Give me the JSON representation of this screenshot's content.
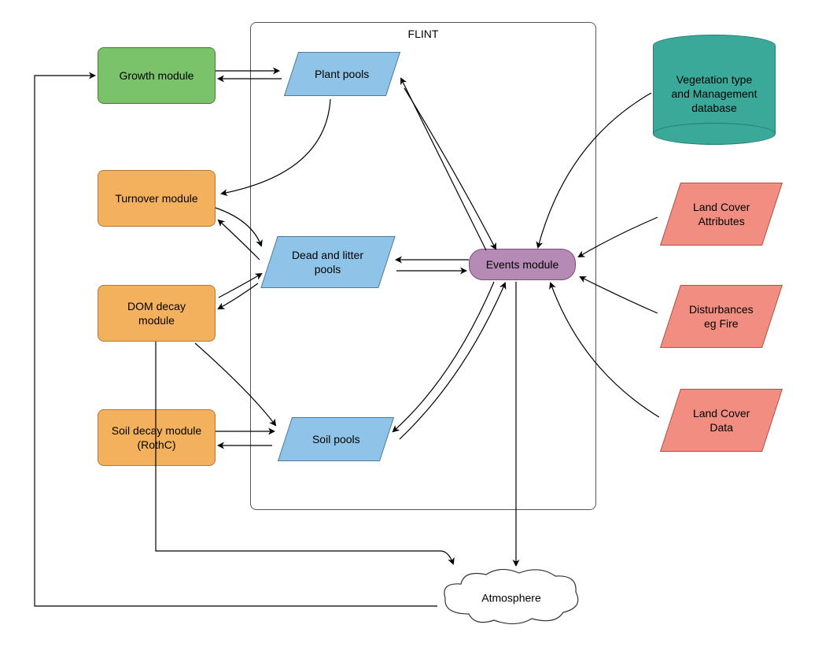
{
  "flint": {
    "label": "FLINT"
  },
  "modules": {
    "growth": "Growth module",
    "turnover": "Turnover module",
    "dom_decay": "DOM decay\nmodule",
    "soil_decay": "Soil decay module\n(RothC)",
    "events": "Events module"
  },
  "pools": {
    "plant": "Plant pools",
    "dead_litter": "Dead and litter\npools",
    "soil": "Soil pools"
  },
  "inputs": {
    "veg_db": "Vegetation type\nand Management\ndatabase",
    "land_cover_attr": "Land Cover\nAttributes",
    "disturbances": "Disturbances\neg Fire",
    "land_cover_data": "Land Cover\nData"
  },
  "sink": {
    "atmosphere": "Atmosphere"
  }
}
